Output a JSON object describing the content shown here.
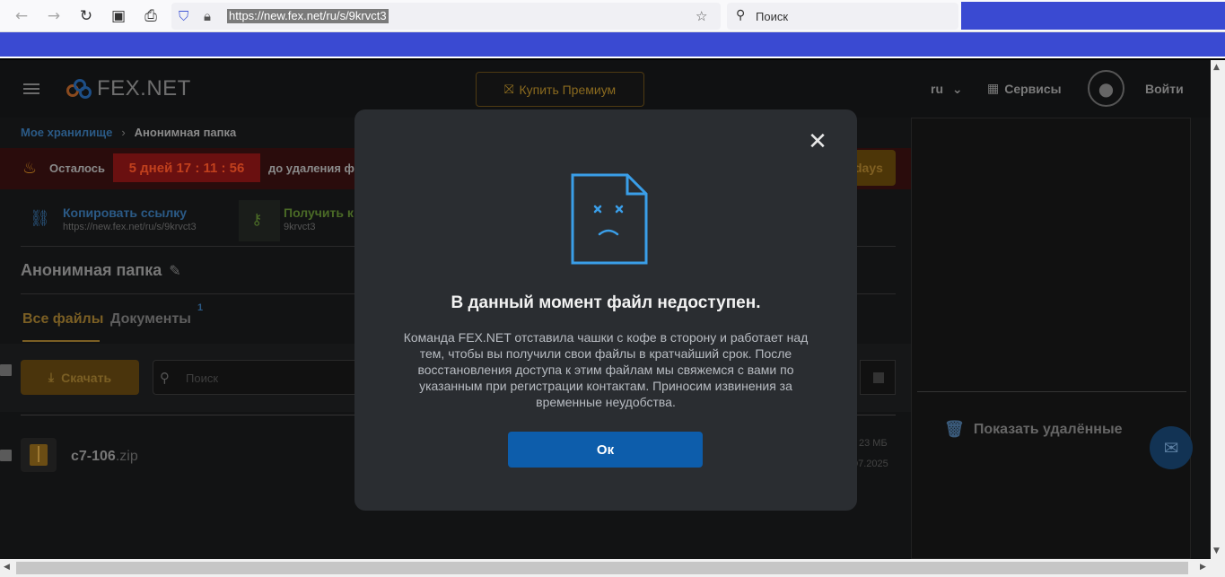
{
  "browser": {
    "url": "https://new.fex.net/ru/s/9krvct3",
    "search_placeholder": "Поиск"
  },
  "header": {
    "logo_text": "FEX.NET",
    "premium_label": "Купить Премиум",
    "language": "ru",
    "services_label": "Сервисы",
    "login_label": "Войти"
  },
  "breadcrumb": {
    "root": "Мое хранилище",
    "current": "Анонимная папка"
  },
  "warning": {
    "prefix": "Осталось",
    "timer": "5 дней  17 : 11 : 56",
    "suffix": "до удаления фа",
    "button_partial": "days"
  },
  "share": {
    "copy_title": "Копировать ссылку",
    "copy_url": "https://new.fex.net/ru/s/9krvct3",
    "key_title": "Получить к",
    "key_value": "9krvct3"
  },
  "folder": {
    "title": "Анонимная папка"
  },
  "tabs": {
    "all": "Все файлы",
    "docs": "Документы",
    "docs_count": "1"
  },
  "toolbar": {
    "download_label": "Скачать",
    "search_placeholder": "Поиск"
  },
  "files": [
    {
      "name": "c7-106",
      "ext": ".zip",
      "size": "23 МБ",
      "date": "07.2025"
    }
  ],
  "side": {
    "show_deleted": "Показать удалённые"
  },
  "modal": {
    "title": "В данный момент файл недоступен.",
    "text": "Команда FEX.NET отставила чашки с кофе в сторону и работает над тем, чтобы вы получили свои файлы в кратчайший срок. После восстановления доступа к этим файлам мы свяжемся с вами по указанным при регистрации контактам. Приносим извинения за временные неудобства.",
    "ok_label": "Ок"
  },
  "colors": {
    "accent_blue": "#0d5dab",
    "modal_bg": "#2a2d31",
    "doc_icon_blue": "#3a9ee8",
    "browser_strip": "#3a4ad2"
  }
}
